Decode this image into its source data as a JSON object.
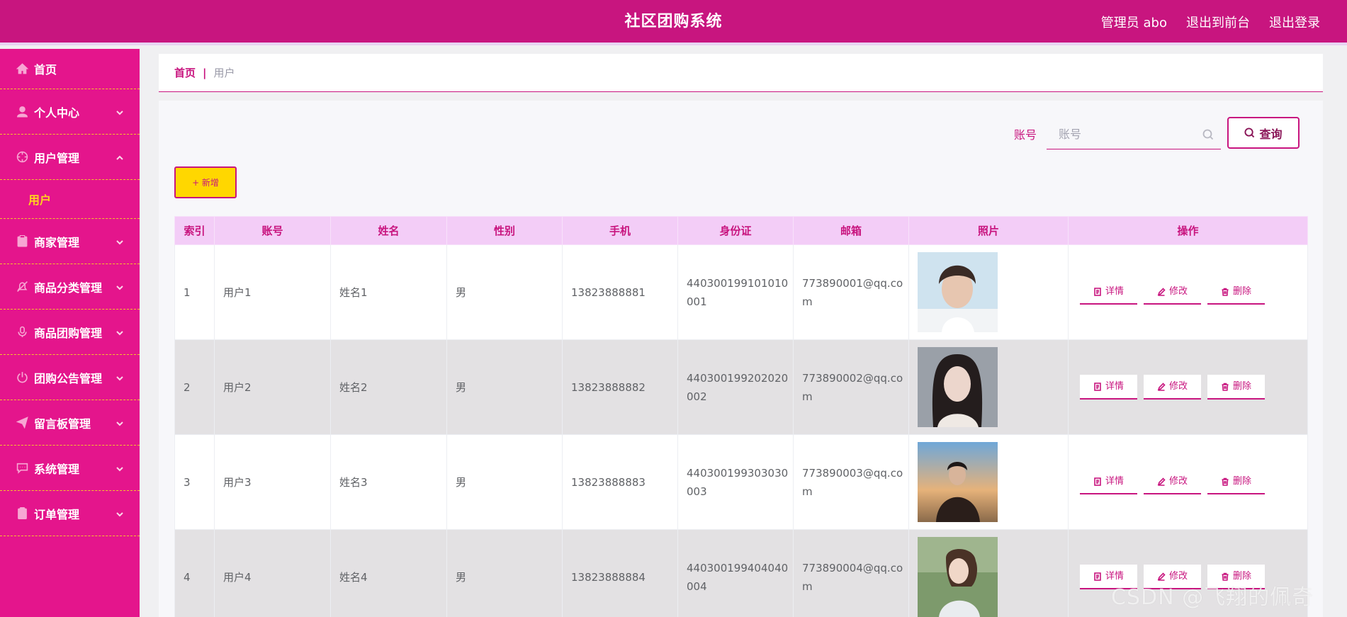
{
  "header": {
    "title": "社区团购系统",
    "user_label": "管理员 abo",
    "to_front": "退出到前台",
    "logout": "退出登录"
  },
  "sidebar": {
    "items": [
      {
        "label": "首页",
        "icon": "home-icon"
      },
      {
        "label": "个人中心",
        "icon": "user-icon"
      },
      {
        "label": "用户管理",
        "icon": "crosshair-icon"
      },
      {
        "label": "商家管理",
        "icon": "store-icon"
      },
      {
        "label": "商品分类管理",
        "icon": "bell-off-icon"
      },
      {
        "label": "商品团购管理",
        "icon": "mic-icon"
      },
      {
        "label": "团购公告管理",
        "icon": "power-icon"
      },
      {
        "label": "留言板管理",
        "icon": "send-icon"
      },
      {
        "label": "系统管理",
        "icon": "chat-icon"
      },
      {
        "label": "订单管理",
        "icon": "clipboard-icon"
      }
    ],
    "sub_item": "用户"
  },
  "breadcrumb": {
    "home": "首页",
    "separator": "|",
    "current": "用户"
  },
  "search": {
    "label": "账号",
    "placeholder": "账号",
    "button": "查询"
  },
  "add_button": "+ 新增",
  "table": {
    "columns": [
      "索引",
      "账号",
      "姓名",
      "性别",
      "手机",
      "身份证",
      "邮箱",
      "照片",
      "操作"
    ],
    "rows": [
      {
        "index": "1",
        "account": "用户1",
        "name": "姓名1",
        "gender": "男",
        "phone": "13823888881",
        "id_card": "440300199101010001",
        "email": "773890001@qq.com"
      },
      {
        "index": "2",
        "account": "用户2",
        "name": "姓名2",
        "gender": "男",
        "phone": "13823888882",
        "id_card": "440300199202020002",
        "email": "773890002@qq.com"
      },
      {
        "index": "3",
        "account": "用户3",
        "name": "姓名3",
        "gender": "男",
        "phone": "13823888883",
        "id_card": "440300199303030003",
        "email": "773890003@qq.com"
      },
      {
        "index": "4",
        "account": "用户4",
        "name": "姓名4",
        "gender": "男",
        "phone": "13823888884",
        "id_card": "440300199404040004",
        "email": "773890004@qq.com"
      }
    ],
    "actions": {
      "detail": "详情",
      "edit": "修改",
      "delete": "删除"
    }
  },
  "watermark": "CSDN @飞翔的佩奇",
  "colors": {
    "primary": "#c8157f",
    "sidebar": "#e4158c",
    "header_bg": "#f3cdf7",
    "add_button": "#ffd700",
    "sub_item": "#ffd21e"
  }
}
